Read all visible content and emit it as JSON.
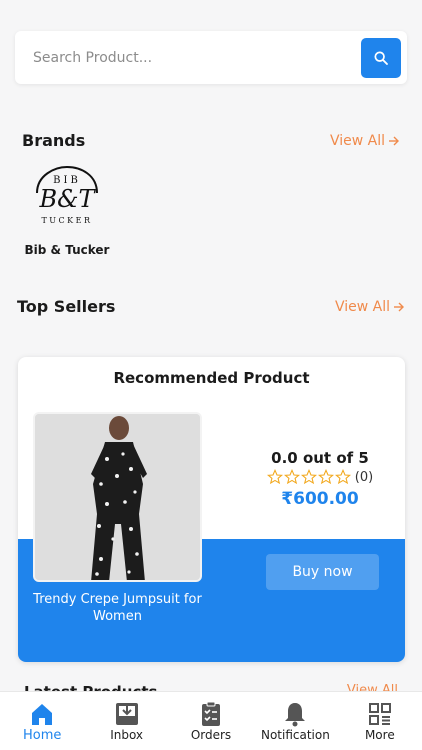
{
  "search": {
    "placeholder": "Search Product..."
  },
  "brands": {
    "title": "Brands",
    "view_all": "View All",
    "items": [
      {
        "name": "Bib & Tucker",
        "logo_top": "BIB",
        "logo_mid": "B&T",
        "logo_bottom": "TUCKER"
      }
    ]
  },
  "top_sellers": {
    "title": "Top Sellers",
    "view_all": "View All"
  },
  "recommended": {
    "title": "Recommended Product",
    "product_name": "Trendy Crepe Jumpsuit for Women",
    "rating_text": "0.0 out of 5",
    "rating_value": 0,
    "max_stars": 5,
    "review_count": "(0)",
    "price": "₹600.00",
    "buy_label": "Buy now"
  },
  "latest": {
    "title": "Latest Products",
    "view_all": "View All"
  },
  "tabs": [
    {
      "label": "Home",
      "icon": "home-icon",
      "active": true
    },
    {
      "label": "Inbox",
      "icon": "inbox-icon",
      "active": false
    },
    {
      "label": "Orders",
      "icon": "orders-icon",
      "active": false
    },
    {
      "label": "Notification",
      "icon": "bell-icon",
      "active": false
    },
    {
      "label": "More",
      "icon": "grid-icon",
      "active": false
    }
  ],
  "colors": {
    "accent": "#1f84ec",
    "link": "#f08a4b",
    "background": "#f6f6f7"
  }
}
